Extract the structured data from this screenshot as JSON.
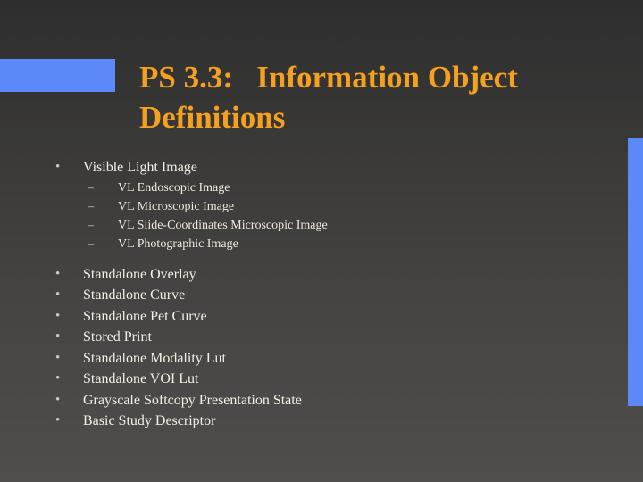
{
  "slide": {
    "title": "PS 3.3:   Information Object\nDefinitions",
    "title_color": "#f5a01e",
    "background_color": "#3d3c3b",
    "body_text_color": "#f3efe2",
    "accent_color": "#5c89f7",
    "bullet_glyph": "•",
    "subbullet_glyph": "–",
    "content": [
      {
        "level": 1,
        "label": "Visible Light Image",
        "children": [
          {
            "level": 2,
            "label": "VL Endoscopic Image"
          },
          {
            "level": 2,
            "label": "VL Microscopic Image"
          },
          {
            "level": 2,
            "label": "VL Slide-Coordinates Microscopic Image"
          },
          {
            "level": 2,
            "label": "VL Photographic Image"
          }
        ]
      },
      {
        "level": 1,
        "label": "Standalone Overlay"
      },
      {
        "level": 1,
        "label": "Standalone Curve"
      },
      {
        "level": 1,
        "label": "Standalone Pet Curve"
      },
      {
        "level": 1,
        "label": "Stored Print"
      },
      {
        "level": 1,
        "label": "Standalone Modality Lut"
      },
      {
        "level": 1,
        "label": "Standalone VOI Lut"
      },
      {
        "level": 1,
        "label": "Grayscale Softcopy Presentation State"
      },
      {
        "level": 1,
        "label": "Basic Study Descriptor"
      }
    ]
  }
}
